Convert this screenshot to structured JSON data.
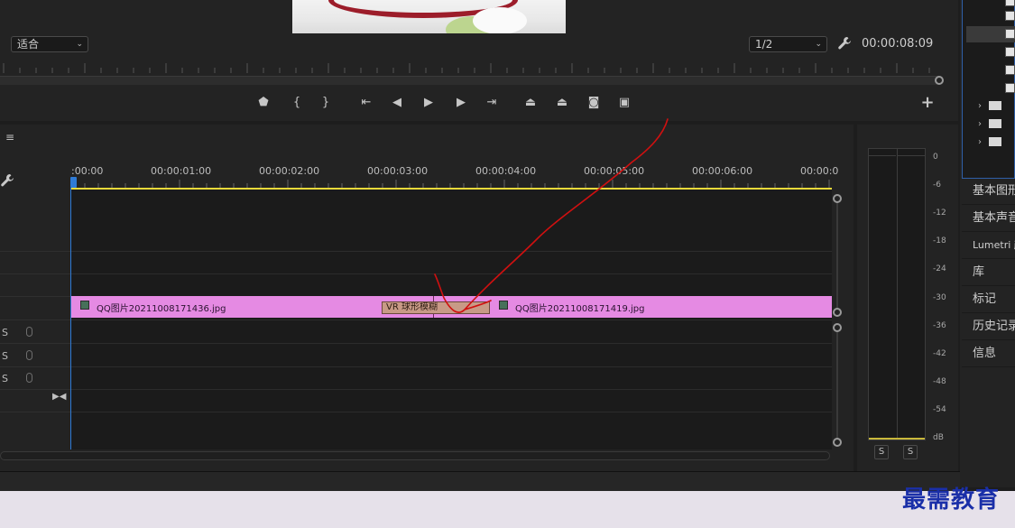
{
  "monitor": {
    "fit_select": "适合",
    "resolution_select": "1/2",
    "timecode": "00:00:08:09"
  },
  "transport": [
    {
      "name": "add-marker-button",
      "glyph": "⬟"
    },
    {
      "name": "mark-in-button",
      "glyph": "{"
    },
    {
      "name": "mark-out-button",
      "glyph": "}"
    },
    {
      "name": "go-to-in-button",
      "glyph": "⇤"
    },
    {
      "name": "step-back-button",
      "glyph": "◀"
    },
    {
      "name": "play-button",
      "glyph": "▶"
    },
    {
      "name": "step-forward-button",
      "glyph": "▶"
    },
    {
      "name": "go-to-out-button",
      "glyph": "⇥"
    },
    {
      "name": "lift-button",
      "glyph": "⏏"
    },
    {
      "name": "extract-button",
      "glyph": "⏏"
    },
    {
      "name": "export-frame-button",
      "glyph": "◙"
    },
    {
      "name": "compare-view-button",
      "glyph": "▣"
    },
    {
      "name": "add-button",
      "glyph": "+"
    }
  ],
  "timeline": {
    "ticks": [
      ":00:00",
      "00:00:01:00",
      "00:00:02:00",
      "00:00:03:00",
      "00:00:04:00",
      "00:00:05:00",
      "00:00:06:00",
      "00:00:0"
    ],
    "clips": [
      {
        "label": "QQ图片20211008171436.jpg"
      },
      {
        "label": "QQ图片20211008171419.jpg"
      }
    ],
    "transition_label": "VR 球形模糊",
    "audio_tracks": [
      "S",
      "S",
      "S"
    ]
  },
  "meter": {
    "db_labels": [
      "0",
      "-6",
      "-12",
      "-18",
      "-24",
      "-30",
      "-36",
      "-42",
      "-48",
      "-54",
      "dB"
    ],
    "solo_buttons": [
      "S",
      "S"
    ]
  },
  "right_panel": {
    "items": [
      "基本图形",
      "基本声音",
      "Lumetri 颜色",
      "库",
      "标记",
      "历史记录",
      "信息"
    ]
  },
  "watermark": "最需教育",
  "colors": {
    "clip": "#e58ae3",
    "playhead": "#2f7bd6",
    "workbar": "#e8d93a",
    "annotation": "#d01010"
  }
}
